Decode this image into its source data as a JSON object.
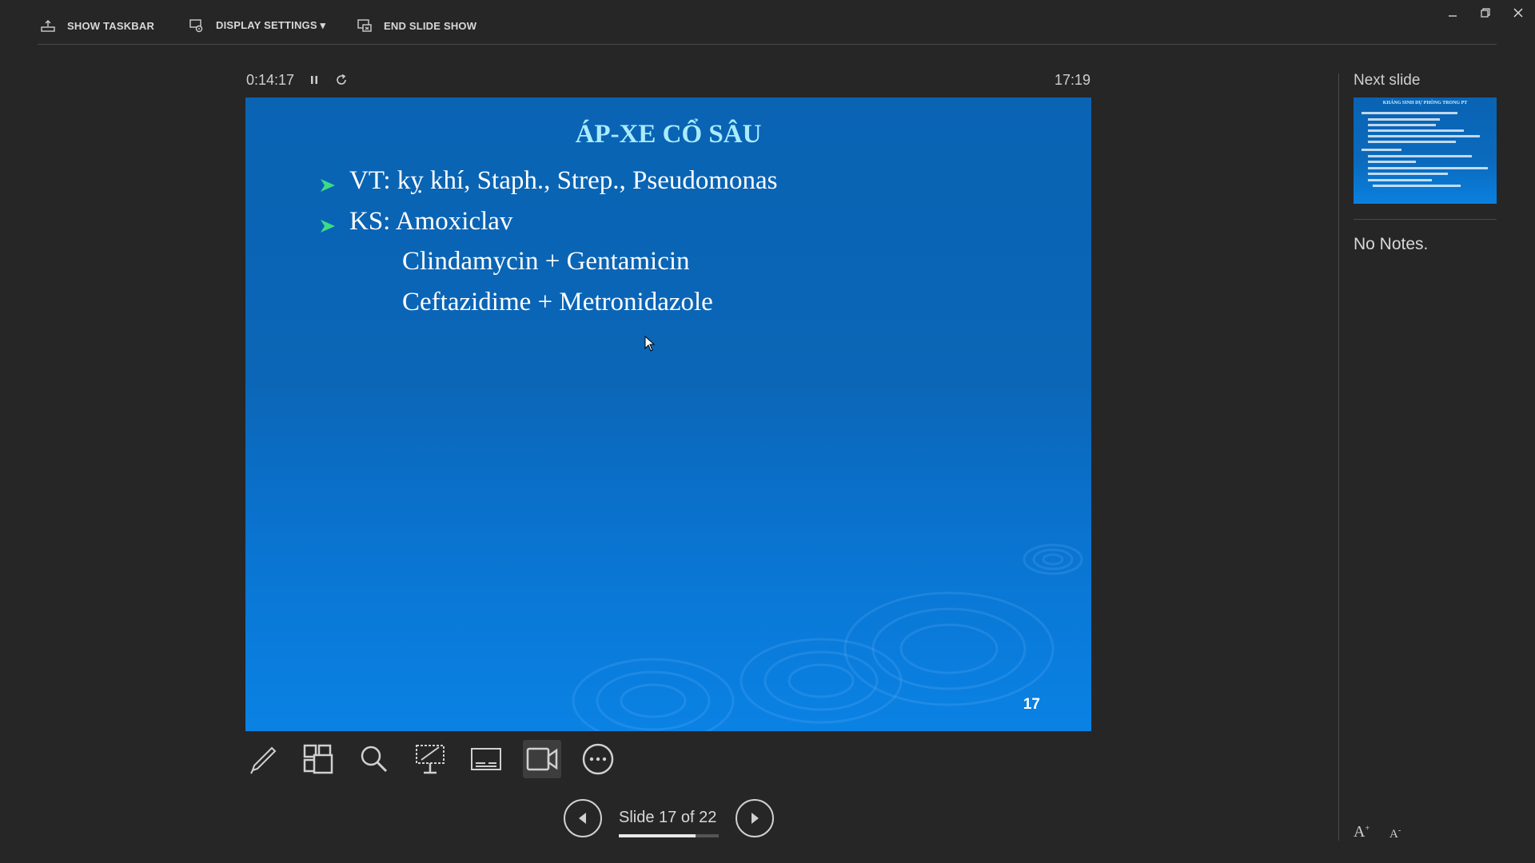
{
  "toolbar": {
    "show_taskbar": "SHOW TASKBAR",
    "display_settings": "DISPLAY SETTINGS ▾",
    "end_slide_show": "END SLIDE SHOW"
  },
  "window_controls": {
    "minimize": "–",
    "restore": "❐",
    "close": "✕"
  },
  "timer": {
    "elapsed": "0:14:17",
    "clock": "17:19"
  },
  "slide": {
    "title": "ÁP-XE CỔ SÂU",
    "bullets": [
      "VT: kỵ khí, Staph., Strep., Pseudomonas",
      "KS: Amoxiclav"
    ],
    "sub_lines": [
      "Clindamycin + Gentamicin",
      "Ceftazidime + Metronidazole"
    ],
    "number": "17"
  },
  "tools": [
    "pen-icon",
    "slide-grid-icon",
    "zoom-icon",
    "pointer-options-icon",
    "subtitles-icon",
    "camera-icon",
    "more-options-icon"
  ],
  "navigation": {
    "counter": "Slide 17 of 22",
    "current": 17,
    "total": 22,
    "progress": 0.77
  },
  "next_slide": {
    "label": "Next slide",
    "thumb_title": "KHÁNG SINH DỰ PHÒNG TRONG PT"
  },
  "notes": "No Notes.",
  "font_controls": {
    "increase": "A",
    "decrease": "A"
  },
  "colors": {
    "background": "#262626",
    "slide_blue": "#0b66b7",
    "title_cyan": "#a8ecff",
    "bullet_green": "#3ddc84"
  }
}
